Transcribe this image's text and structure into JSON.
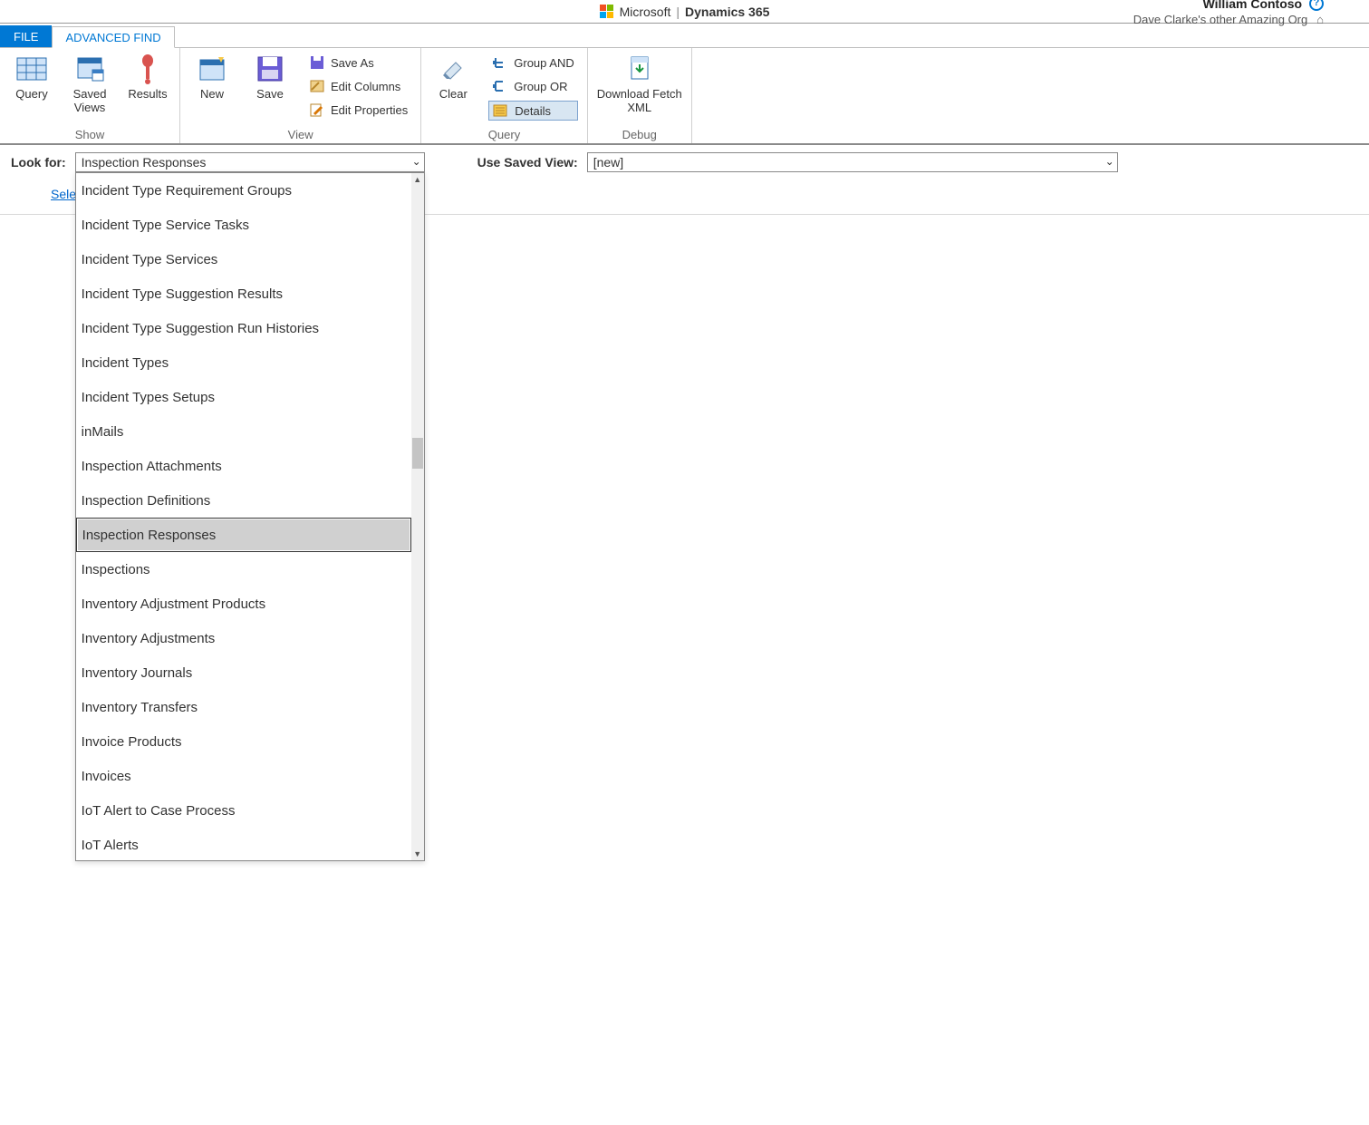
{
  "topbar": {
    "brand_ms": "Microsoft",
    "brand_product": "Dynamics 365",
    "user_name": "William Contoso",
    "org_name": "Dave Clarke's other Amazing Org"
  },
  "tabs": {
    "file": "FILE",
    "advanced_find": "ADVANCED FIND"
  },
  "ribbon": {
    "show": {
      "label": "Show",
      "query": "Query",
      "saved_views": "Saved\nViews",
      "results": "Results"
    },
    "view": {
      "label": "View",
      "new": "New",
      "save": "Save",
      "save_as": "Save As",
      "edit_columns": "Edit Columns",
      "edit_properties": "Edit Properties"
    },
    "query": {
      "label": "Query",
      "clear": "Clear",
      "group_and": "Group AND",
      "group_or": "Group OR",
      "details": "Details"
    },
    "debug": {
      "label": "Debug",
      "download_fetch_xml": "Download Fetch\nXML"
    }
  },
  "lookfor": {
    "label": "Look for:",
    "value": "Inspection Responses",
    "options": [
      "Incident Type Requirement Groups",
      "Incident Type Service Tasks",
      "Incident Type Services",
      "Incident Type Suggestion Results",
      "Incident Type Suggestion Run Histories",
      "Incident Types",
      "Incident Types Setups",
      "inMails",
      "Inspection Attachments",
      "Inspection Definitions",
      "Inspection Responses",
      "Inspections",
      "Inventory Adjustment Products",
      "Inventory Adjustments",
      "Inventory Journals",
      "Inventory Transfers",
      "Invoice Products",
      "Invoices",
      "IoT Alert to Case Process",
      "IoT Alerts"
    ],
    "selected_index": 10
  },
  "saved_view": {
    "label": "Use Saved View:",
    "value": "[new]"
  },
  "select_link": "Sele"
}
